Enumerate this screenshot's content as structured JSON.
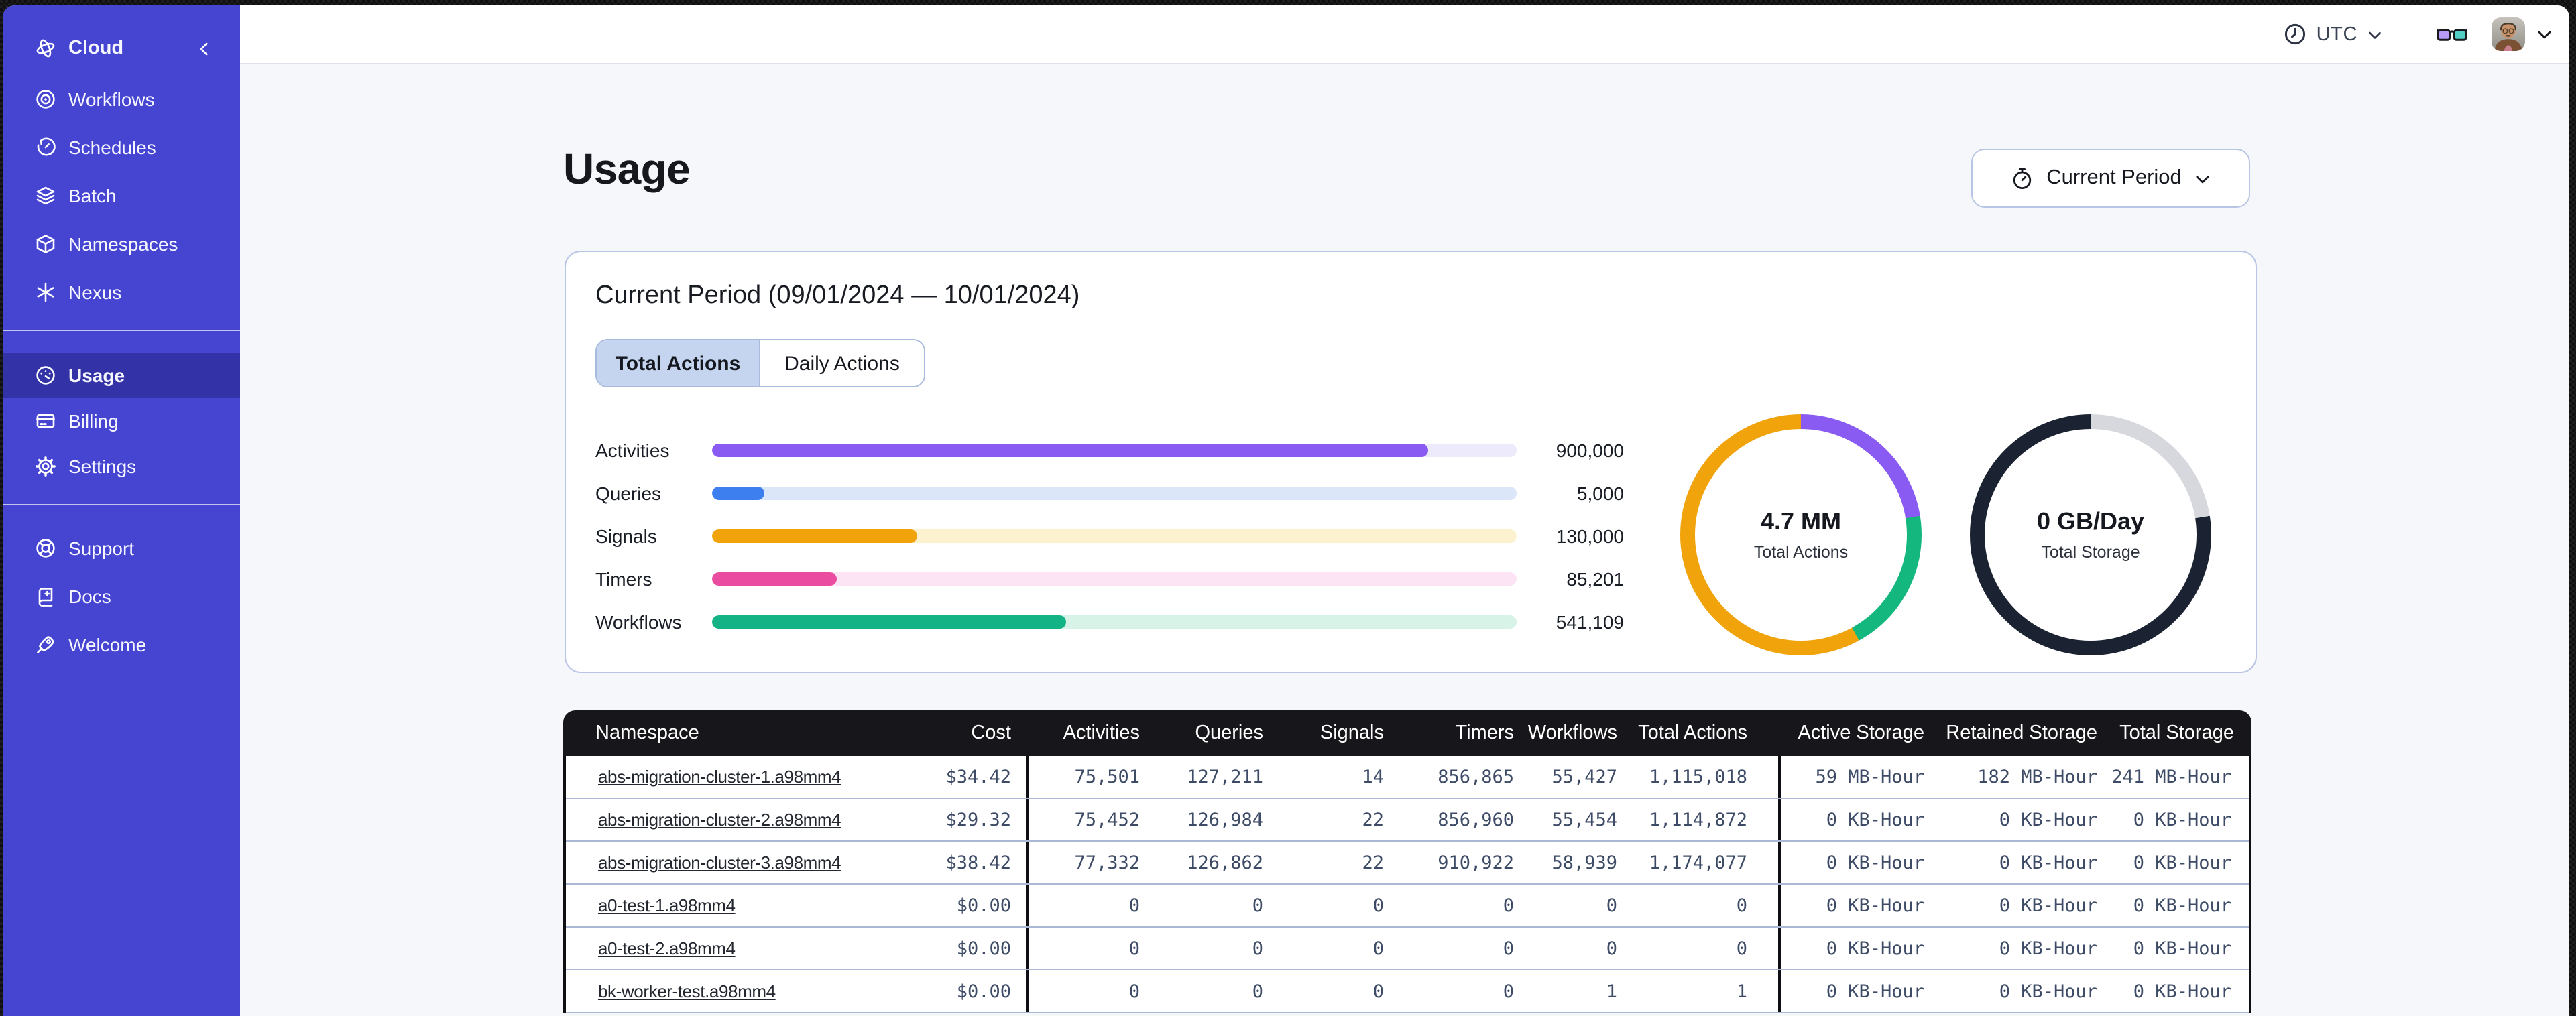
{
  "topbar": {
    "timezone": "UTC"
  },
  "sidebar": {
    "app_label": "Cloud",
    "nav": [
      {
        "label": "Workflows"
      },
      {
        "label": "Schedules"
      },
      {
        "label": "Batch"
      },
      {
        "label": "Namespaces"
      },
      {
        "label": "Nexus"
      }
    ],
    "account": [
      {
        "label": "Usage"
      },
      {
        "label": "Billing"
      },
      {
        "label": "Settings"
      }
    ],
    "misc": [
      {
        "label": "Support"
      },
      {
        "label": "Docs"
      },
      {
        "label": "Welcome"
      }
    ]
  },
  "page": {
    "title": "Usage",
    "period_button_label": "Current Period"
  },
  "period_card": {
    "heading": "Current Period (09/01/2024 — 10/01/2024)",
    "tabs": [
      {
        "label": "Total Actions"
      },
      {
        "label": "Daily Actions"
      }
    ],
    "bars": [
      {
        "label": "Activities",
        "value": "900,000",
        "pct": "89%",
        "fill": "#8a5bf2",
        "track": "#eceafb"
      },
      {
        "label": "Queries",
        "value": "5,000",
        "pct": "6.5%",
        "fill": "#3e7ff0",
        "track": "#dbe6f9"
      },
      {
        "label": "Signals",
        "value": "130,000",
        "pct": "25.5%",
        "fill": "#f0a30b",
        "track": "#fcf2cf"
      },
      {
        "label": "Timers",
        "value": "85,201",
        "pct": "15.5%",
        "fill": "#ea4d9f",
        "track": "#fce4f5"
      },
      {
        "label": "Workflows",
        "value": "541,109",
        "pct": "44%",
        "fill": "#13b385",
        "track": "#d7f3e7"
      }
    ],
    "donuts": {
      "actions": {
        "value": "4.7 MM",
        "caption": "Total Actions",
        "segments": [
          {
            "color": "#8a5bf2",
            "pct": 22.5
          },
          {
            "color": "#14b87e",
            "pct": 19.5
          },
          {
            "color": "#f0a30b",
            "pct": 58
          }
        ]
      },
      "storage": {
        "value": "0 GB/Day",
        "caption": "Total Storage",
        "segments": [
          {
            "color": "#d6d8dd",
            "pct": 22.5
          },
          {
            "color": "#1b2232",
            "pct": 77.5
          }
        ]
      }
    }
  },
  "usage_table": {
    "columns": {
      "namespace": "Namespace",
      "cost": "Cost",
      "activities": "Activities",
      "queries": "Queries",
      "signals": "Signals",
      "timers": "Timers",
      "workflows": "Workflows",
      "total_actions": "Total Actions",
      "active_storage": "Active Storage",
      "retained_storage": "Retained Storage",
      "total_storage": "Total Storage"
    },
    "rows": [
      {
        "ns": "abs-migration-cluster-1.a98mm4",
        "cost": "$34.42",
        "activities": "75,501",
        "queries": "127,211",
        "signals": "14",
        "timers": "856,865",
        "workflows": "55,427",
        "total_actions": "1,115,018",
        "active_storage": "59 MB-Hour",
        "retained_storage": "182 MB-Hour",
        "total_storage": "241 MB-Hour"
      },
      {
        "ns": "abs-migration-cluster-2.a98mm4",
        "cost": "$29.32",
        "activities": "75,452",
        "queries": "126,984",
        "signals": "22",
        "timers": "856,960",
        "workflows": "55,454",
        "total_actions": "1,114,872",
        "active_storage": "0 KB-Hour",
        "retained_storage": "0 KB-Hour",
        "total_storage": "0 KB-Hour"
      },
      {
        "ns": "abs-migration-cluster-3.a98mm4",
        "cost": "$38.42",
        "activities": "77,332",
        "queries": "126,862",
        "signals": "22",
        "timers": "910,922",
        "workflows": "58,939",
        "total_actions": "1,174,077",
        "active_storage": "0 KB-Hour",
        "retained_storage": "0 KB-Hour",
        "total_storage": "0 KB-Hour"
      },
      {
        "ns": "a0-test-1.a98mm4",
        "cost": "$0.00",
        "activities": "0",
        "queries": "0",
        "signals": "0",
        "timers": "0",
        "workflows": "0",
        "total_actions": "0",
        "active_storage": "0 KB-Hour",
        "retained_storage": "0 KB-Hour",
        "total_storage": "0 KB-Hour"
      },
      {
        "ns": "a0-test-2.a98mm4",
        "cost": "$0.00",
        "activities": "0",
        "queries": "0",
        "signals": "0",
        "timers": "0",
        "workflows": "0",
        "total_actions": "0",
        "active_storage": "0 KB-Hour",
        "retained_storage": "0 KB-Hour",
        "total_storage": "0 KB-Hour"
      },
      {
        "ns": "bk-worker-test.a98mm4",
        "cost": "$0.00",
        "activities": "0",
        "queries": "0",
        "signals": "0",
        "timers": "0",
        "workflows": "1",
        "total_actions": "1",
        "active_storage": "0 KB-Hour",
        "retained_storage": "0 KB-Hour",
        "total_storage": "0 KB-Hour"
      }
    ]
  }
}
